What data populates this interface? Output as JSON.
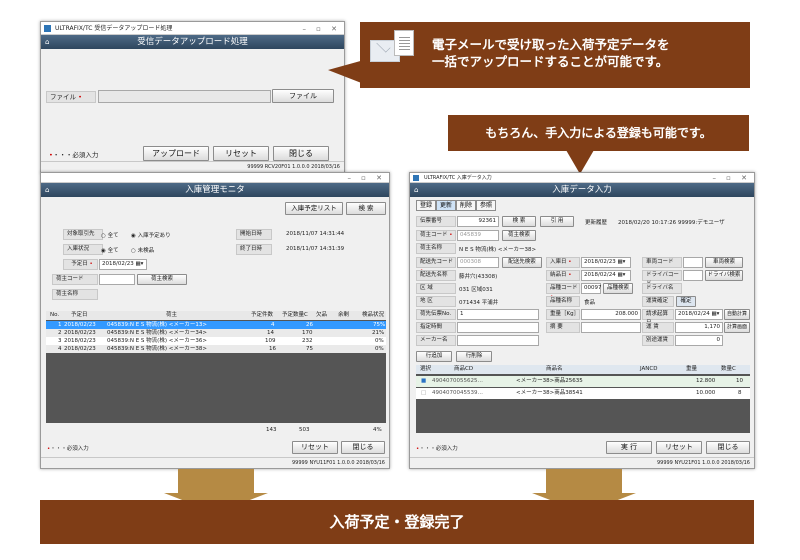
{
  "callout_email": {
    "line1": "電子メールで受け取った入荷予定データを",
    "line2": "一括でアップロードすることが可能です。"
  },
  "callout_manual": "もちろん、手入力による登録も可能です。",
  "banner": "入荷予定・登録完了",
  "colors": {
    "callout": "#7f3d16",
    "arrow": "#b58a44",
    "banner": "#7f3d16",
    "header": "#3d5570",
    "selected_row": "#3399ff"
  },
  "upload": {
    "titlebar": "ULTRAFIX/TC 受信データアップロード処理",
    "header": "受信データアップロード処理",
    "file_label": "ファイル",
    "file_button": "ファイル",
    "required_note": "・・・必須入力",
    "upload_button": "アップロード",
    "reset_button": "リセット",
    "close_button": "閉じる",
    "status": "99999  RCV20F01  1.0.0.0  2018/03/16"
  },
  "monitor": {
    "titlebar": "",
    "header": "入庫管理モニタ",
    "list_button": "入庫予定リスト",
    "search_button": "検 索",
    "target_label": "対象取引先",
    "target_opt1": "全て",
    "target_opt2": "入庫予定あり",
    "status_label": "入庫状況",
    "status_opt1": "全て",
    "status_opt2": "未検品",
    "date_label": "予定日",
    "date_value": "2018/02/23",
    "owner_code_label": "荷主コード",
    "owner_search": "荷主検索",
    "owner_name_label": "荷主名称",
    "start_label": "開始日時",
    "start_value": "2018/11/07 14:31:44",
    "end_label": "終了日時",
    "end_value": "2018/11/07 14:31:39",
    "columns": [
      "No.",
      "予定日",
      "荷主",
      "予定件数",
      "予定数量C",
      "欠品",
      "余剰",
      "検品状況"
    ],
    "rows": [
      [
        "1",
        "2018/02/23",
        "045839:N E S 物流(株) <メーカー13>",
        "4",
        "26",
        "",
        "",
        "75%"
      ],
      [
        "2",
        "2018/02/23",
        "045839:N E S 物流(株) <メーカー34>",
        "14",
        "170",
        "",
        "",
        "21%"
      ],
      [
        "3",
        "2018/02/23",
        "045839:N E S 物流(株) <メーカー36>",
        "109",
        "232",
        "",
        "",
        "0%"
      ],
      [
        "4",
        "2018/02/23",
        "045839:N E S 物流(株) <メーカー38>",
        "16",
        "75",
        "",
        "",
        "0%"
      ]
    ],
    "total_count": "143",
    "total_qty": "503",
    "total_rate": "4%",
    "required_note": "・・・必須入力",
    "reset_button": "リセット",
    "close_button": "閉じる",
    "status": "99999  NYU11F01  1.0.0.0  2018/03/16"
  },
  "entry": {
    "titlebar": "ULTRAFIX/TC 入庫データ入力",
    "header": "入庫データ入力",
    "tabs": [
      "登録",
      "更新",
      "削除",
      "参照"
    ],
    "slip_label": "伝票番号",
    "slip_value": "92361",
    "search_button": "検 索",
    "cite_button": "引 用",
    "history_label": "更新履歴",
    "history_value": "2018/02/20 10:17:26 99999:デモユーザ",
    "owner_code_label": "荷主コード",
    "owner_code_value": "045839",
    "owner_search": "荷主検索",
    "owner_name_label": "荷主名称",
    "owner_name_value": "N E S 物流(株)  <メーカー38>",
    "dest_code_label": "配送先コード",
    "dest_code_value": "000308",
    "dest_search": "配送先検索",
    "dest_name_label": "配送先名称",
    "dest_name_value": "藤井穴(43308)",
    "area_label": "区 域",
    "area_value": "031 区域031",
    "district_label": "地 区",
    "district_value": "071434 平浦井",
    "arrival_label": "入庫日",
    "arrival_value": "2018/02/23",
    "delivery_label": "納品日",
    "delivery_value": "2018/02/24",
    "product_code_label": "品種コード",
    "product_code_value": "00097",
    "product_search": "品種検索",
    "product_name_label": "品種名称",
    "product_name_value": "食品",
    "vehicle_code_label": "車両コード",
    "vehicle_search": "車両検索",
    "driver_code_label": "ドライバコード",
    "driver_search": "ドライバ検索",
    "driver_name_label": "ドライバ名",
    "freight_label": "運賃確定",
    "freight_value": "確定",
    "shipper_slip_label": "荷先伝票No.",
    "shipper_slip_value": "1",
    "weight_label": "重量［Kg］",
    "weight_value": "208.000",
    "billing_date_label": "請求起算日",
    "billing_date_value": "2018/02/24",
    "auto_calc": "自動計算",
    "designated_time_label": "指定時間",
    "remarks_label": "摘 要",
    "fare_label": "運 賃",
    "fare_value": "1,170",
    "calc_screen": "計算画面",
    "maker_label": "メーカー名",
    "extra_fare_label": "別途運賃",
    "extra_fare_value": "0",
    "add_row": "行追加",
    "delete_row": "行削除",
    "columns": [
      "選択",
      "商品CD",
      "",
      "商品名",
      "JANCD",
      "重量",
      "数量C"
    ],
    "rows": [
      [
        "4904070055625…",
        "<メーカー38>商品25635",
        "",
        "12.800",
        "10"
      ],
      [
        "4904070045539…",
        "<メーカー38>商品38541",
        "",
        "10.000",
        "8"
      ]
    ],
    "required_note": "・・・必須入力",
    "execute_button": "実 行",
    "reset_button": "リセット",
    "close_button": "閉じる",
    "status": "99999  NYU21F01  1.0.0.0  2018/03/16"
  }
}
